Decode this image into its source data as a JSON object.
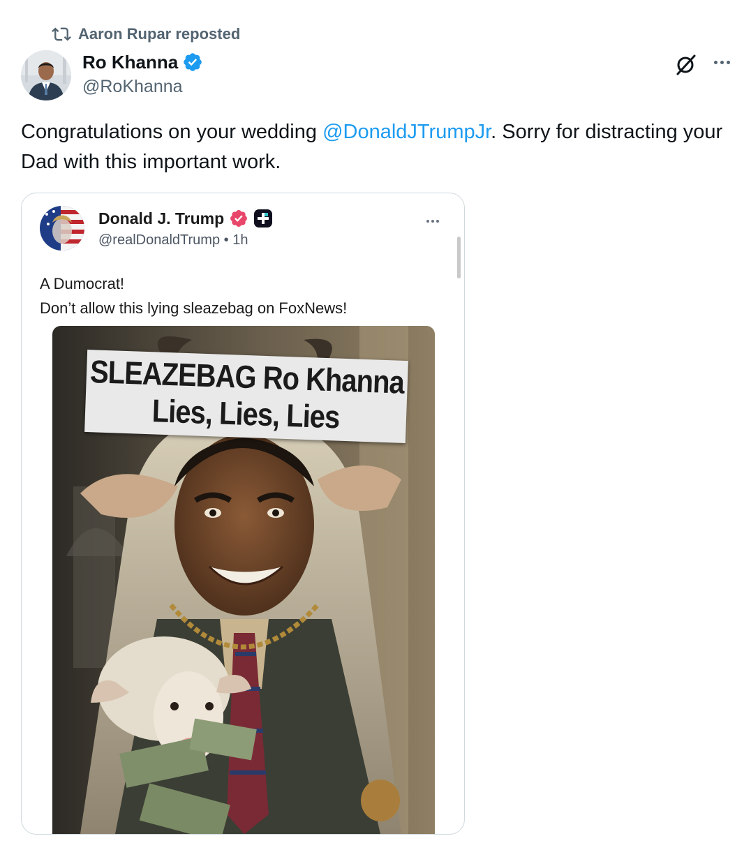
{
  "repost": {
    "label": "Aaron Rupar reposted"
  },
  "author": {
    "name": "Ro Khanna",
    "handle": "@RoKhanna"
  },
  "tweet": {
    "text_before": "Congratulations on your wedding ",
    "mention": "@DonaldJTrumpJr",
    "text_after": ". Sorry for distracting your Dad with this important work."
  },
  "embedded_post": {
    "name": "Donald J. Trump",
    "handle": "@realDonaldTrump",
    "separator": "•",
    "time": "1h",
    "line1": "A Dumocrat!",
    "line2": "Don’t allow this lying sleazebag on FoxNews!",
    "image": {
      "banner_line1": "SLEAZEBAG Ro Khanna",
      "banner_line2": "Lies, Lies, Lies"
    }
  },
  "colors": {
    "link": "#1d9bf0",
    "verified": "#1d9bf0",
    "truth_badge": "#e8466b",
    "muted": "#536471"
  },
  "icons": {
    "repost": "repost-icon",
    "verified": "verified-badge-icon",
    "grok": "grok-icon",
    "more": "more-options-icon"
  }
}
